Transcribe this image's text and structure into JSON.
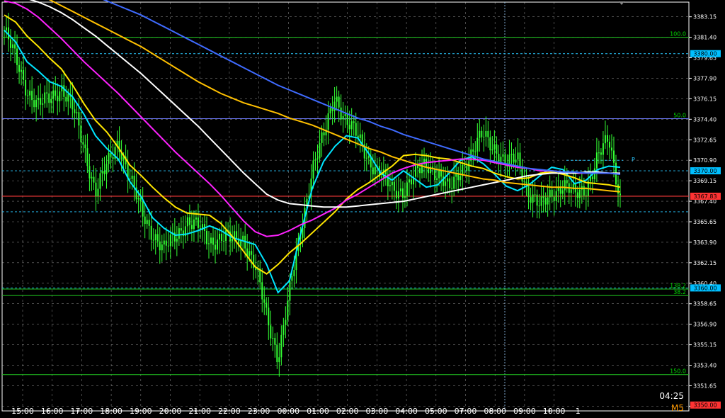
{
  "chart_data": {
    "type": "candlestick",
    "symbol_timeframe": "M5",
    "countdown": "04:25",
    "ylim": [
      3349.5,
      3384.4
    ],
    "y_ticks": [
      "3383.15",
      "3381.40",
      "3379.65",
      "3377.90",
      "3376.15",
      "3374.40",
      "3372.65",
      "3370.90",
      "3369.15",
      "3367.40",
      "3365.65",
      "3363.90",
      "3362.15",
      "3360.40",
      "3358.65",
      "3356.90",
      "3355.15",
      "3353.40",
      "3351.65",
      "3349.90"
    ],
    "x_ticks": [
      "15:00",
      "16:00",
      "17:00",
      "18:00",
      "19:00",
      "20:00",
      "21:00",
      "22:00",
      "23:00",
      "00:00",
      "01:00",
      "02:00",
      "03:00",
      "04:00",
      "05:00",
      "07:00",
      "08:00",
      "09:00",
      "10:00"
    ],
    "x_tick_last": "1",
    "price_boxes": [
      {
        "label": "3380.00",
        "value": 3380.0,
        "color": "#00bfff"
      },
      {
        "label": "3370.00",
        "value": 3370.0,
        "color": "#00bfff"
      },
      {
        "label": "3367.83",
        "value": 3367.83,
        "color": "#ff3333"
      },
      {
        "label": "3360.00",
        "value": 3360.0,
        "color": "#00bfff"
      },
      {
        "label": "3350.00",
        "value": 3350.0,
        "color": "#ff3333"
      }
    ],
    "fib_levels": [
      {
        "label": "100.0",
        "value": 3381.4
      },
      {
        "label": "50.0",
        "value": 3374.45
      },
      {
        "label": "138.2",
        "value": 3359.9
      },
      {
        "label": "38.2",
        "value": 3359.35
      },
      {
        "label": "150.0",
        "value": 3352.6
      }
    ],
    "pivot_label": "P",
    "pivot_value": 3370.9,
    "horizontal_dashed": [
      3380.0,
      3370.0,
      3366.5,
      3360.0
    ],
    "close_price": 3367.83,
    "series": [
      {
        "color": "#00e5ff",
        "values": [
          3382.0,
          3381.0,
          3379.3,
          3378.5,
          3377.6,
          3377.2,
          3376.3,
          3374.8,
          3373.0,
          3371.9,
          3371.0,
          3369.1,
          3367.8,
          3366.0,
          3365.1,
          3364.5,
          3364.6,
          3364.9,
          3365.3,
          3364.9,
          3364.3,
          3364.0,
          3363.7,
          3362.0,
          3359.6,
          3360.6,
          3364.7,
          3368.5,
          3370.8,
          3372.1,
          3373.0,
          3372.8,
          3371.4,
          3369.8,
          3369.2,
          3370.0,
          3369.3,
          3368.6,
          3368.8,
          3369.8,
          3370.9,
          3371.2,
          3370.6,
          3369.7,
          3368.7,
          3368.3,
          3368.8,
          3369.6,
          3370.3,
          3370.1,
          3368.9,
          3369.2,
          3370.1,
          3370.4,
          3370.3
        ]
      },
      {
        "color": "#ffe600",
        "values": [
          3383.3,
          3382.7,
          3381.5,
          3380.6,
          3379.6,
          3378.7,
          3377.3,
          3375.7,
          3374.3,
          3373.3,
          3372.0,
          3370.5,
          3369.6,
          3368.6,
          3367.7,
          3366.9,
          3366.4,
          3366.3,
          3366.2,
          3365.5,
          3364.4,
          3363.1,
          3361.8,
          3361.2,
          3362.0,
          3363.0,
          3363.8,
          3364.7,
          3365.6,
          3366.5,
          3367.6,
          3368.4,
          3369.0,
          3369.7,
          3370.4,
          3371.3,
          3371.4,
          3371.3,
          3371.1,
          3371.0,
          3370.7,
          3370.4,
          3370.2,
          3369.8,
          3369.5,
          3369.3,
          3369.4,
          3369.8,
          3369.9,
          3369.7,
          3369.4,
          3369.0,
          3368.9,
          3368.8,
          3368.6
        ]
      },
      {
        "color": "#ff22ff",
        "values": [
          3384.5,
          3384.3,
          3383.8,
          3383.1,
          3382.2,
          3381.3,
          3380.3,
          3379.3,
          3378.4,
          3377.5,
          3376.6,
          3375.6,
          3374.6,
          3373.6,
          3372.6,
          3371.6,
          3370.7,
          3369.8,
          3368.9,
          3367.9,
          3366.8,
          3365.7,
          3364.8,
          3364.4,
          3364.5,
          3364.9,
          3365.4,
          3365.8,
          3366.3,
          3366.8,
          3367.5,
          3368.0,
          3368.6,
          3369.2,
          3369.8,
          3370.2,
          3370.5,
          3370.7,
          3370.8,
          3370.9,
          3371.0,
          3371.0,
          3370.9,
          3370.7,
          3370.5,
          3370.3,
          3370.2,
          3370.0,
          3370.0,
          3369.9,
          3369.8,
          3369.8,
          3369.8,
          3369.8,
          3369.7
        ]
      },
      {
        "color": "#ffffff",
        "values": [
          3385.0,
          3384.9,
          3384.7,
          3384.4,
          3384.0,
          3383.5,
          3382.9,
          3382.2,
          3381.5,
          3380.7,
          3379.9,
          3379.1,
          3378.3,
          3377.4,
          3376.5,
          3375.6,
          3374.7,
          3373.8,
          3372.8,
          3371.8,
          3370.8,
          3369.8,
          3368.9,
          3368.0,
          3367.5,
          3367.2,
          3367.1,
          3367.0,
          3366.9,
          3366.9,
          3366.9,
          3367.0,
          3367.1,
          3367.2,
          3367.3,
          3367.4,
          3367.6,
          3367.8,
          3368.0,
          3368.2,
          3368.4,
          3368.6,
          3368.8,
          3369.0,
          3369.2,
          3369.4,
          3369.6,
          3369.7,
          3369.8,
          3369.8,
          3369.8,
          3369.9,
          3369.9,
          3369.8,
          3369.8
        ]
      },
      {
        "color": "#ffc000",
        "values": [
          3386.0,
          3385.8,
          3385.5,
          3385.1,
          3384.6,
          3384.1,
          3383.6,
          3383.1,
          3382.6,
          3382.1,
          3381.6,
          3381.1,
          3380.6,
          3380.0,
          3379.4,
          3378.8,
          3378.2,
          3377.6,
          3377.1,
          3376.6,
          3376.2,
          3375.8,
          3375.5,
          3375.2,
          3374.9,
          3374.5,
          3374.2,
          3373.9,
          3373.5,
          3373.1,
          3372.7,
          3372.3,
          3371.9,
          3371.6,
          3371.2,
          3370.9,
          3370.6,
          3370.3,
          3370.1,
          3369.9,
          3369.7,
          3369.5,
          3369.3,
          3369.2,
          3369.0,
          3368.9,
          3368.8,
          3368.7,
          3368.6,
          3368.6,
          3368.5,
          3368.5,
          3368.4,
          3368.3,
          3368.2
        ]
      },
      {
        "color": "#3f6bff",
        "values": [
          3387.0,
          3386.9,
          3386.7,
          3386.5,
          3386.2,
          3385.9,
          3385.6,
          3385.3,
          3384.9,
          3384.5,
          3384.1,
          3383.7,
          3383.3,
          3382.8,
          3382.3,
          3381.8,
          3381.3,
          3380.8,
          3380.3,
          3379.8,
          3379.3,
          3378.8,
          3378.3,
          3377.8,
          3377.3,
          3376.9,
          3376.5,
          3376.1,
          3375.7,
          3375.3,
          3374.9,
          3374.5,
          3374.2,
          3373.8,
          3373.5,
          3373.1,
          3372.8,
          3372.5,
          3372.2,
          3371.9,
          3371.6,
          3371.3,
          3371.0,
          3370.8,
          3370.6,
          3370.4,
          3370.2,
          3370.1,
          3370.0,
          3369.9,
          3369.9,
          3369.8,
          3369.8,
          3369.8,
          3369.7
        ]
      }
    ],
    "price_path": [
      3382.0,
      3379.5,
      3377.0,
      3375.5,
      3376.2,
      3377.2,
      3375.3,
      3372.0,
      3368.3,
      3370.3,
      3372.6,
      3369.4,
      3366.5,
      3364.8,
      3363.2,
      3364.4,
      3365.8,
      3365.1,
      3364.0,
      3364.4,
      3364.0,
      3364.3,
      3361.8,
      3357.5,
      3354.2,
      3359.5,
      3364.8,
      3370.3,
      3372.8,
      3376.5,
      3374.2,
      3372.8,
      3371.0,
      3369.6,
      3368.4,
      3368.4,
      3369.5,
      3370.7,
      3369.8,
      3368.2,
      3370.2,
      3371.4,
      3373.1,
      3372.1,
      3370.4,
      3371.1,
      3368.2,
      3366.8,
      3368.1,
      3368.9,
      3367.8,
      3368.6,
      3371.1,
      3372.6,
      3367.8
    ]
  }
}
